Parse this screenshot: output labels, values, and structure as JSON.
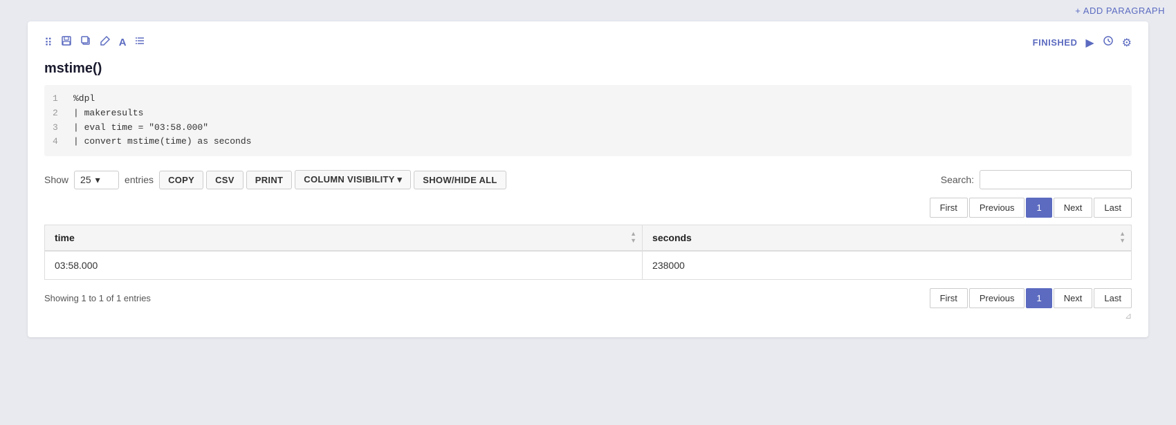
{
  "topbar": {
    "add_paragraph": "+ ADD PARAGRAPH"
  },
  "toolbar": {
    "icons": [
      "move-icon",
      "save-icon",
      "copy-icon",
      "brush-icon",
      "text-icon",
      "list-icon"
    ],
    "finished_label": "FINISHED",
    "play_icon": "▶",
    "clock_icon": "🕐",
    "settings_icon": "⚙"
  },
  "section": {
    "title": "mstime()"
  },
  "code": {
    "lines": [
      {
        "num": "1",
        "text": "%dpl"
      },
      {
        "num": "2",
        "text": "| makeresults"
      },
      {
        "num": "3",
        "text": "| eval time = \"03:58.000\""
      },
      {
        "num": "4",
        "text": "| convert mstime(time) as seconds"
      }
    ]
  },
  "table_controls": {
    "show_label": "Show",
    "entries_value": "25",
    "entries_label": "entries",
    "buttons": [
      "COPY",
      "CSV",
      "PRINT",
      "COLUMN VISIBILITY ▾",
      "SHOW/HIDE ALL"
    ],
    "search_label": "Search:",
    "search_placeholder": ""
  },
  "pagination_top": {
    "buttons": [
      "First",
      "Previous",
      "1",
      "Next",
      "Last"
    ],
    "active": "1"
  },
  "table": {
    "columns": [
      "time",
      "seconds"
    ],
    "rows": [
      {
        "time": "03:58.000",
        "seconds": "238000"
      }
    ]
  },
  "table_footer": {
    "showing": "Showing 1 to 1 of 1 entries"
  },
  "pagination_bottom": {
    "buttons": [
      "First",
      "Previous",
      "1",
      "Next",
      "Last"
    ],
    "active": "1"
  }
}
